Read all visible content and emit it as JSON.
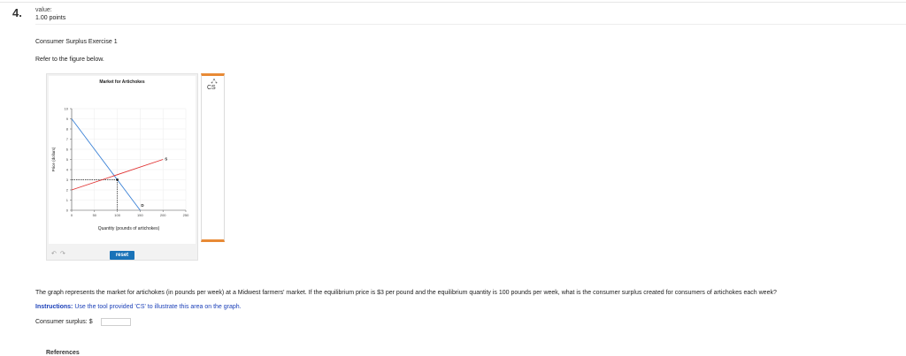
{
  "question": {
    "number": "4.",
    "value_label": "value:",
    "points": "1.00 points",
    "exercise_title": "Consumer Surplus Exercise 1",
    "refer_text": "Refer to the figure below.",
    "body_text": "The graph represents the market for artichokes (in pounds per week) at a Midwest farmers' market. If the equilibrium price is $3 per pound and the equilibrium quantity is 100 pounds per week, what is the consumer surplus created for consumers of artichokes each week?",
    "instructions_label": "Instructions:",
    "instructions_text": " Use the tool provided 'CS' to illustrate this area on the graph.",
    "answer_label": "Consumer surplus: $",
    "answer_value": "",
    "references_label": "References"
  },
  "graph": {
    "title": "Market for Artichokes",
    "xlabel": "Quantity (pounds of artichokes)",
    "ylabel": "Price (dollars)",
    "demand_label": "D",
    "supply_label": "S",
    "tool_label": "CS",
    "tool_icon": "cs-tool-icon",
    "undo_icon": "undo-icon",
    "redo_icon": "redo-icon",
    "reset_label": "reset"
  },
  "chart_data": {
    "type": "line",
    "title": "Market for Artichokes",
    "xlabel": "Quantity (pounds of artichokes)",
    "ylabel": "Price (dollars)",
    "xlim": [
      0,
      250
    ],
    "ylim": [
      0,
      10
    ],
    "x_ticks": [
      0,
      50,
      100,
      150,
      200,
      250
    ],
    "y_ticks": [
      0,
      1,
      2,
      3,
      4,
      5,
      6,
      7,
      8,
      9,
      10
    ],
    "grid": true,
    "series": [
      {
        "name": "D",
        "color": "#3b82d6",
        "points": [
          [
            0,
            9
          ],
          [
            150,
            0
          ]
        ]
      },
      {
        "name": "S",
        "color": "#e03030",
        "points": [
          [
            0,
            2
          ],
          [
            200,
            5
          ]
        ]
      }
    ],
    "equilibrium": {
      "x": 100,
      "y": 3
    }
  }
}
